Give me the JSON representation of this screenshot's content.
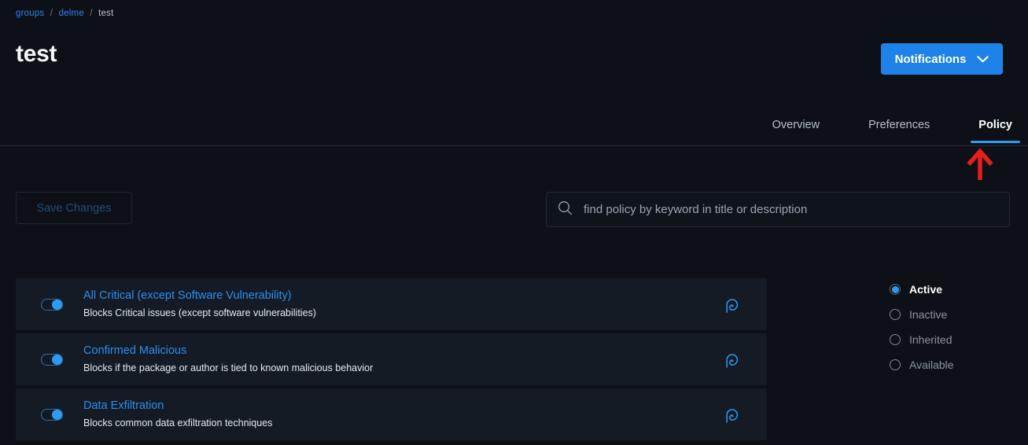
{
  "breadcrumb": {
    "items": [
      "groups",
      "delme",
      "test"
    ],
    "separator": "/"
  },
  "header": {
    "title": "test",
    "notifications_button": {
      "label": "Notifications",
      "icon": "chevron-down-icon",
      "color": "#1f82e8"
    }
  },
  "tabs": [
    {
      "label": "Overview",
      "active": false
    },
    {
      "label": "Preferences",
      "active": false
    },
    {
      "label": "Policy",
      "active": true
    }
  ],
  "annotation": {
    "type": "arrow-up",
    "color": "#e81d1d",
    "points_at": "Policy"
  },
  "toolbar": {
    "save_label": "Save Changes",
    "save_disabled": true,
    "search": {
      "icon": "search-icon",
      "value": "",
      "placeholder": "find policy by keyword in title or description"
    }
  },
  "policies": [
    {
      "title": "All Critical (except Software Vulnerability)",
      "description": "Blocks Critical issues (except software vulnerabilities)",
      "enabled": true,
      "icon": "policy-provider-p-icon"
    },
    {
      "title": "Confirmed Malicious",
      "description": "Blocks if the package or author is tied to known malicious behavior",
      "enabled": true,
      "icon": "policy-provider-p-icon"
    },
    {
      "title": "Data Exfiltration",
      "description": "Blocks common data exfiltration techniques",
      "enabled": true,
      "icon": "policy-provider-p-icon"
    }
  ],
  "filters": [
    {
      "label": "Active",
      "selected": true
    },
    {
      "label": "Inactive",
      "selected": false
    },
    {
      "label": "Inherited",
      "selected": false
    },
    {
      "label": "Available",
      "selected": false
    }
  ],
  "theme": {
    "background": "#0d1117",
    "card": "#151b25",
    "accent": "#2b9bf4",
    "link": "#2b8ef0",
    "annotation": "#e81d1d"
  }
}
